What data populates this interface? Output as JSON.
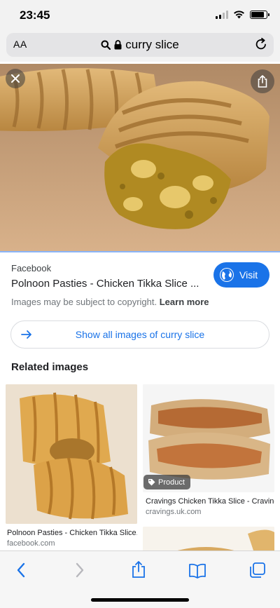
{
  "status": {
    "time": "23:45"
  },
  "browser": {
    "aa_label": "AA",
    "url_text": "curry slice"
  },
  "result": {
    "source": "Facebook",
    "title": "Polnoon Pasties - Chicken Tikka Slice ...",
    "visit_label": "Visit",
    "copyright_text": "Images may be subject to copyright.",
    "learn_more": "Learn more",
    "show_all_label": "Show all images of curry slice",
    "related_heading": "Related images"
  },
  "related": [
    {
      "caption": "Polnoon Pasties - Chicken Tikka Slice...",
      "domain": "facebook.com"
    },
    {
      "caption": "Cravings Chicken Tikka Slice - Cravings",
      "domain": "cravings.uk.com",
      "badge": "Product"
    }
  ],
  "colors": {
    "accent": "#1a73e8",
    "visit_bg": "#1a73e8"
  }
}
